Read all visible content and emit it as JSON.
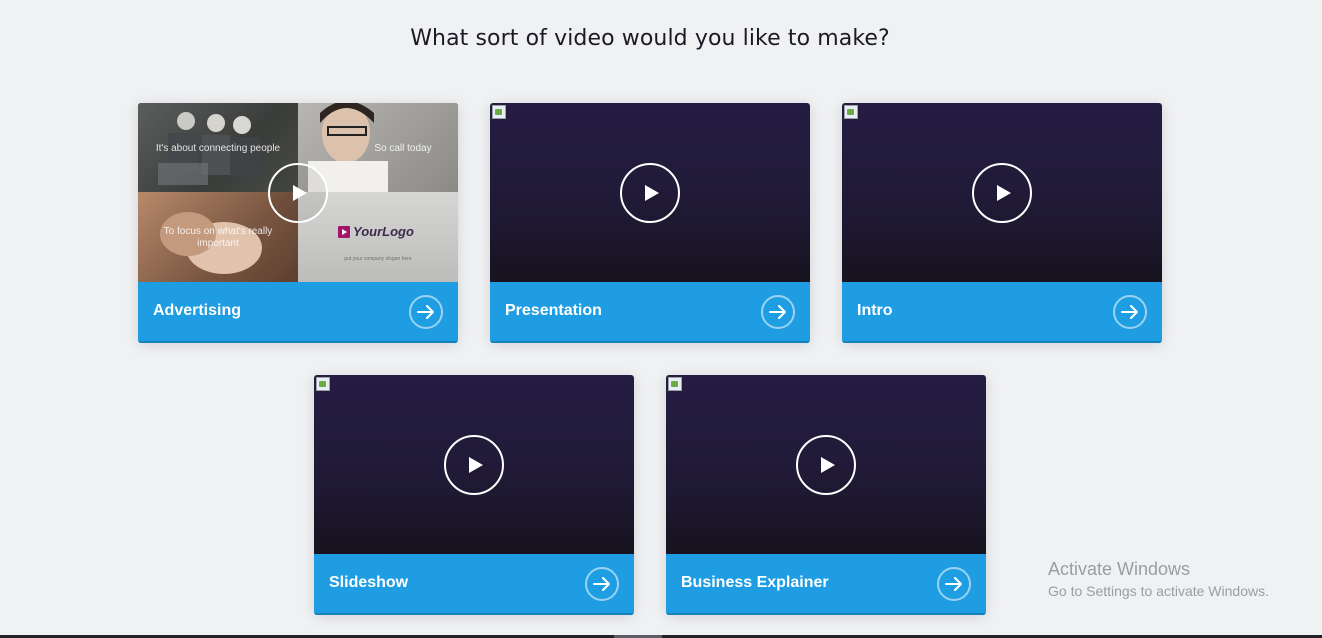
{
  "heading": "What sort of video would you like to make?",
  "cards": [
    {
      "label": "Advertising"
    },
    {
      "label": "Presentation"
    },
    {
      "label": "Intro"
    },
    {
      "label": "Slideshow"
    },
    {
      "label": "Business Explainer"
    }
  ],
  "advertising_preview": {
    "caption_1": "It's about connecting people",
    "caption_2": "So call today",
    "caption_3": "To focus on what's really important",
    "logo_text": "YourLogo",
    "tagline": "put your company slogan here"
  },
  "watermark": {
    "title": "Activate Windows",
    "subtitle": "Go to Settings to activate Windows."
  },
  "colors": {
    "accent": "#1f9de3",
    "thumbnail_dark": "#221a3c",
    "background": "#f0f1f3"
  },
  "icons": {
    "play": "play-icon",
    "arrow": "arrow-right-icon",
    "broken_image": "broken-image-icon"
  }
}
